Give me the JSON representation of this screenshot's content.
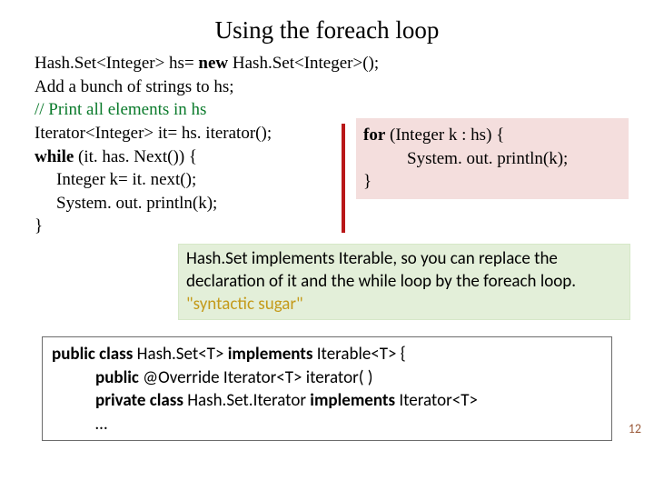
{
  "title": "Using the foreach loop",
  "code": {
    "l1a": "Hash.Set<Integer> hs=  ",
    "l1kw": "new",
    "l1b": " Hash.Set<Integer>();",
    "l2": "Add a bunch of strings to hs;",
    "l3": "// Print all elements in hs",
    "l4": "Iterator<Integer> it=  hs. iterator();",
    "l5kw": "while",
    "l5a": " (it. has. Next()) {",
    "l6": "Integer k=  it. next();",
    "l7": "System. out. println(k);",
    "l8": "}"
  },
  "foreach": {
    "l1kw": "for",
    "l1a": " (Integer  k : hs) {",
    "l2": "System. out. println(k);",
    "l3": "}"
  },
  "note": {
    "p1a": "Hash.Set ",
    "p1b": "implements ",
    "p1c": "Iterable",
    "p1d": ", so you can replace the declaration of ",
    "p1e": "it",
    "p1f": " and the while loop by the foreach loop.   ",
    "sugar": "\"syntactic sugar\""
  },
  "bottom": {
    "l1a": "public class ",
    "l1b": "Hash.Set<T>  ",
    "l1c": "implements",
    "l1d": "  Iterable<T> {",
    "l2a": "public ",
    "l2b": "@Override Iterator<T> iterator( )",
    "l3a": "private class ",
    "l3b": "Hash.Set.Iterator ",
    "l3c": "implements",
    "l3d": " Iterator<T>",
    "l4": "…"
  },
  "page": "12"
}
